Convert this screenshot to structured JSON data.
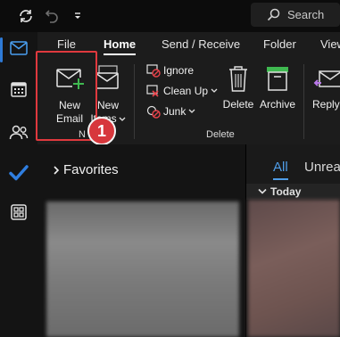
{
  "titlebar": {
    "search_label": "Search"
  },
  "ribbon": {
    "tabs": [
      {
        "label": "File"
      },
      {
        "label": "Home"
      },
      {
        "label": "Send / Receive"
      },
      {
        "label": "Folder"
      },
      {
        "label": "View"
      }
    ],
    "active_tab": "Home",
    "new_email": {
      "line1": "New",
      "line2": "Email"
    },
    "new_items": {
      "line1": "New",
      "line2": "Items"
    },
    "new_group_label": "N",
    "delete_group": {
      "ignore": "Ignore",
      "clean_up": "Clean Up",
      "junk": "Junk",
      "delete": "Delete",
      "archive": "Archive",
      "group_label": "Delete"
    },
    "reply": "Reply"
  },
  "annotation": {
    "step_number": "1",
    "highlight_color": "#e0393e"
  },
  "folder_pane": {
    "favorites_label": "Favorites"
  },
  "message_list": {
    "filter_all": "All",
    "filter_unread": "Unread",
    "group_today": "Today"
  },
  "colors": {
    "accent": "#2e7ad6",
    "link_blue": "#4f9de8",
    "new_email_plus": "#3fb950"
  },
  "icons": [
    "refresh-icon",
    "undo-icon",
    "quick-access-dropdown-icon",
    "search-icon",
    "mail-icon",
    "calendar-icon",
    "people-icon",
    "todo-check-icon",
    "apps-icon",
    "new-email-icon",
    "new-items-icon",
    "ignore-icon",
    "clean-up-icon",
    "junk-icon",
    "delete-icon",
    "archive-icon",
    "reply-icon",
    "chevron-right-icon",
    "chevron-down-icon",
    "collapse-caret-icon"
  ]
}
